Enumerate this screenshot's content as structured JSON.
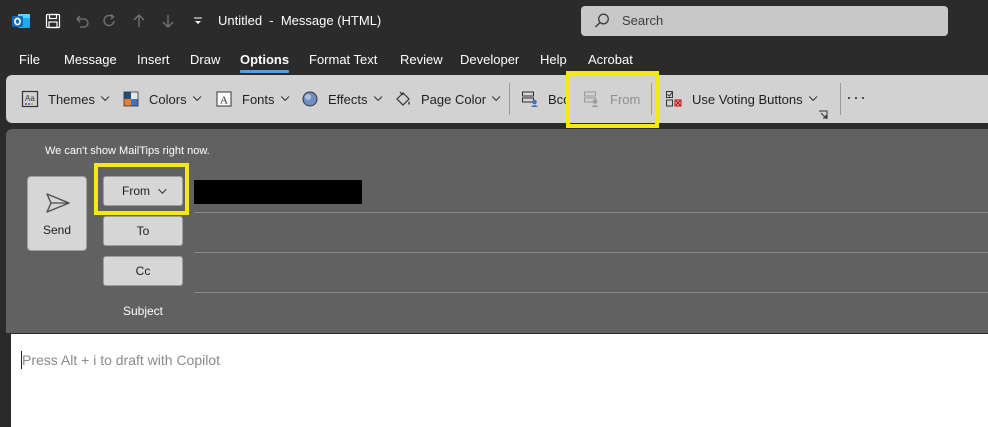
{
  "titlebar": {
    "document_title": "Untitled  -  Message (HTML)",
    "search_placeholder": "Search"
  },
  "menu": {
    "tabs": [
      {
        "label": "File"
      },
      {
        "label": "Message"
      },
      {
        "label": "Insert"
      },
      {
        "label": "Draw"
      },
      {
        "label": "Options",
        "active": true
      },
      {
        "label": "Format Text"
      },
      {
        "label": "Review"
      },
      {
        "label": "Developer"
      },
      {
        "label": "Help"
      },
      {
        "label": "Acrobat"
      }
    ]
  },
  "ribbon": {
    "themes": "Themes",
    "colors": "Colors",
    "fonts": "Fonts",
    "effects": "Effects",
    "page_color": "Page Color",
    "bcc": "Bcc",
    "from": "From",
    "voting": "Use Voting Buttons",
    "more": "···"
  },
  "compose": {
    "mailtips_message": "We can't show MailTips right now.",
    "send_label": "Send",
    "from_label": "From",
    "to_label": "To",
    "cc_label": "Cc",
    "subject_label": "Subject"
  },
  "body": {
    "placeholder": "Press Alt + i to draft with Copilot"
  },
  "colors": {
    "highlight": "#f4e81b",
    "active_tab_underline": "#4ea1e8",
    "outlook_blue": "#0f6cbd"
  }
}
